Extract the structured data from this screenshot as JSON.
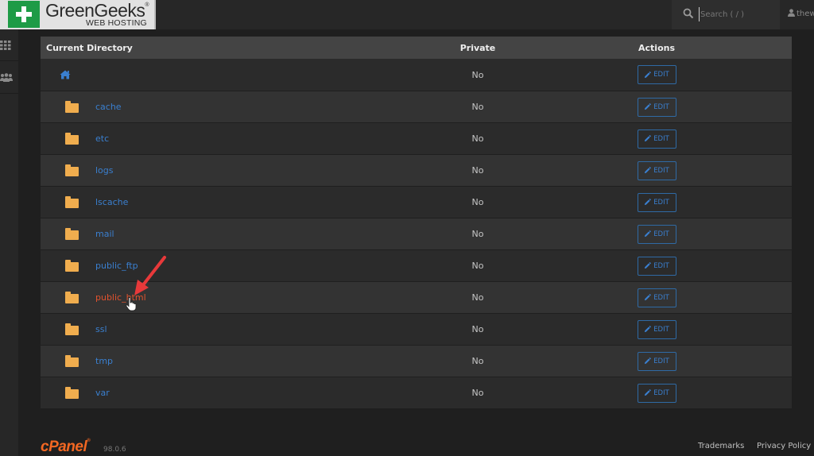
{
  "header": {
    "logo": {
      "brand": "GreenGeeks",
      "registered": "®",
      "tagline": "WEB HOSTING",
      "accent_color": "#1e9b46"
    },
    "search": {
      "placeholder": "Search ( / )",
      "value": "",
      "icon": "search-icon"
    },
    "user": {
      "icon": "user-icon",
      "label": "thew"
    }
  },
  "sidebar": {
    "items": [
      {
        "icon": "grid-icon",
        "label": "Tools"
      },
      {
        "icon": "users-icon",
        "label": "Users"
      }
    ]
  },
  "table": {
    "columns": [
      "Current Directory",
      "Private",
      "Actions"
    ],
    "rows": [
      {
        "name": "",
        "icon": "home-icon",
        "private": "No",
        "action": "EDIT"
      },
      {
        "name": "cache",
        "icon": "folder-icon",
        "private": "No",
        "action": "EDIT"
      },
      {
        "name": "etc",
        "icon": "folder-icon",
        "private": "No",
        "action": "EDIT"
      },
      {
        "name": "logs",
        "icon": "folder-icon",
        "private": "No",
        "action": "EDIT"
      },
      {
        "name": "lscache",
        "icon": "folder-icon",
        "private": "No",
        "action": "EDIT"
      },
      {
        "name": "mail",
        "icon": "folder-icon",
        "private": "No",
        "action": "EDIT"
      },
      {
        "name": "public_ftp",
        "icon": "folder-icon",
        "private": "No",
        "action": "EDIT"
      },
      {
        "name": "public_html",
        "icon": "folder-icon",
        "private": "No",
        "action": "EDIT",
        "hovered": true
      },
      {
        "name": "ssl",
        "icon": "folder-icon",
        "private": "No",
        "action": "EDIT"
      },
      {
        "name": "tmp",
        "icon": "folder-icon",
        "private": "No",
        "action": "EDIT"
      },
      {
        "name": "var",
        "icon": "folder-icon",
        "private": "No",
        "action": "EDIT"
      }
    ]
  },
  "footer": {
    "brand": "cPanel",
    "registered": "®",
    "version": "98.0.6",
    "links": [
      "Trademarks",
      "Privacy Policy"
    ],
    "brand_color": "#f26722"
  },
  "colors": {
    "link": "#3a7fcf",
    "link_hover": "#e0522e",
    "folder": "#f0ad4e",
    "annotation_arrow": "#e8393a"
  }
}
